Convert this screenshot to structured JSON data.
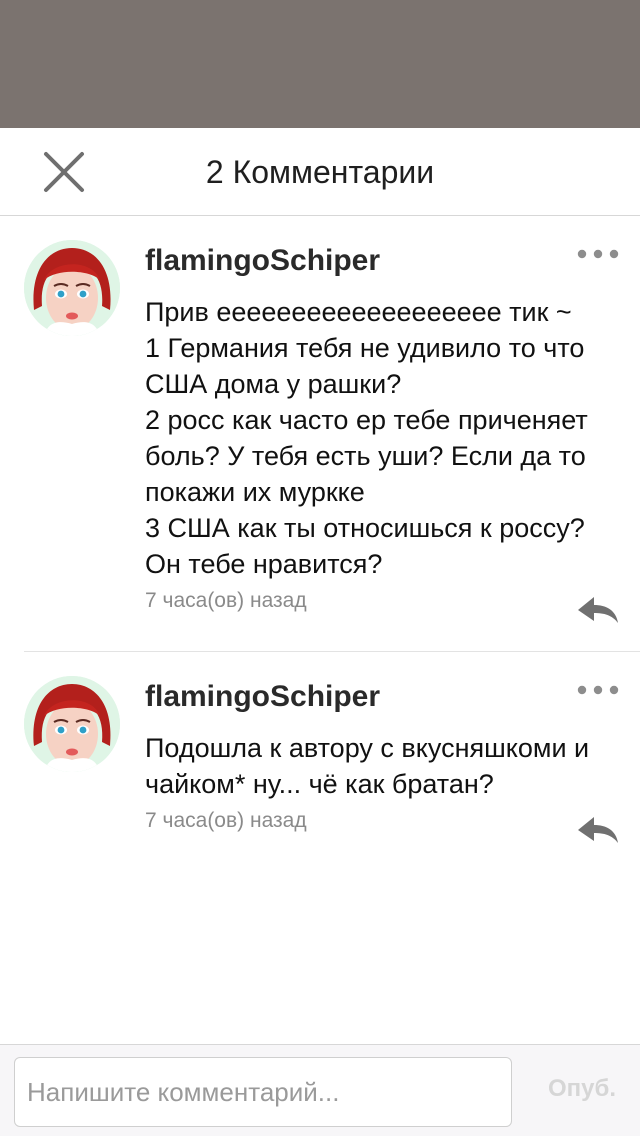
{
  "header": {
    "title": "2 Комментарии",
    "close_icon": "close-icon"
  },
  "comments": [
    {
      "username": "flamingoSchiper",
      "text": "Прив еееееееееееееееееее тик ~\n1 Германия тебя не удивило то что США дома у рашки?\n2 росс как часто ер тебе приченяет боль? У тебя есть уши? Если да то покажи их муркке\n3 США  как ты относишься к россу? Он тебе нравится?",
      "time": "7 часа(ов) назад",
      "more_icon": "more-icon",
      "reply_icon": "reply-icon"
    },
    {
      "username": "flamingoSchiper",
      "text": "Подошла к автору с вкусняшкоми и чайком* ну... чё как братан?",
      "time": "7 часа(ов) назад",
      "more_icon": "more-icon",
      "reply_icon": "reply-icon"
    }
  ],
  "composer": {
    "placeholder": "Напишите комментарий...",
    "value": "",
    "publish_label": "Опуб."
  },
  "colors": {
    "backdrop": "#7b736f",
    "accent_text": "#1f1f1f",
    "icon_gray": "#7a7a7a",
    "disabled": "#d6d6d6"
  }
}
